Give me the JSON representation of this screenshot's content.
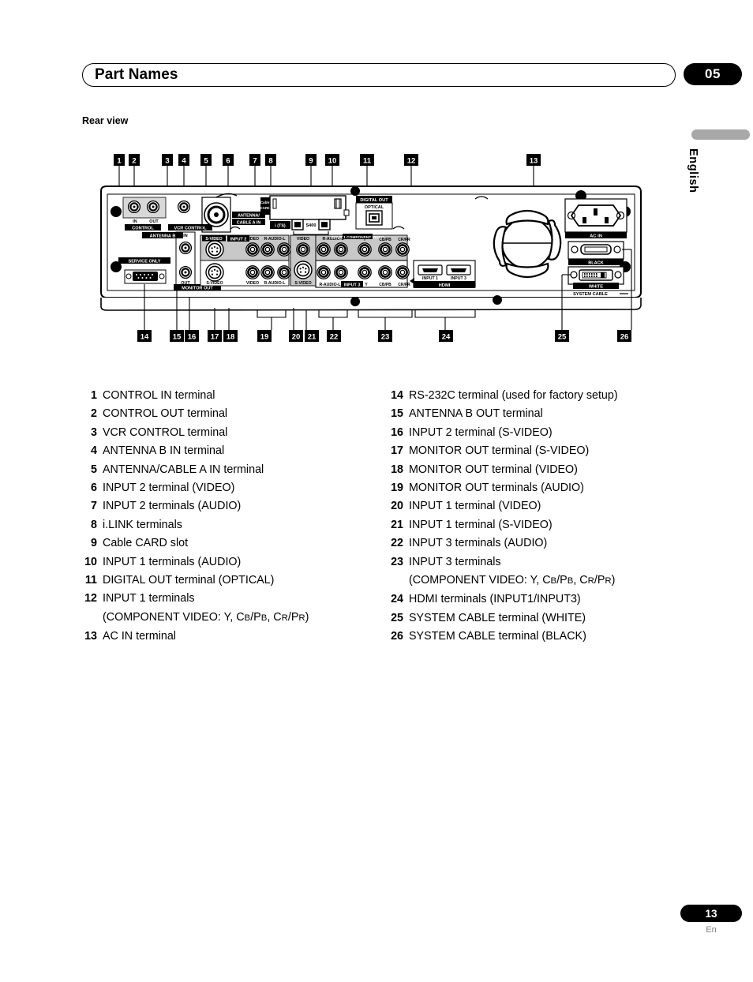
{
  "header": {
    "title": "Part Names",
    "chapter": "05"
  },
  "section": {
    "label": "Rear view"
  },
  "margin": {
    "language": "English"
  },
  "footer": {
    "page_number": "13",
    "language_code": "En"
  },
  "diagram": {
    "name": "rear-panel-connector-diagram",
    "top_callouts": [
      "1",
      "2",
      "3",
      "4",
      "5",
      "6",
      "7",
      "8",
      "9",
      "10",
      "11",
      "12",
      "13"
    ],
    "bottom_callouts": [
      "14",
      "15",
      "16",
      "17",
      "18",
      "19",
      "20",
      "21",
      "22",
      "23",
      "24",
      "25",
      "26"
    ],
    "panel_labels": [
      "IN",
      "OUT",
      "CONTROL",
      "VCR CONTROL",
      "ANTENNA B",
      "IN",
      "OUT",
      "ANTENNA/",
      "CABLE A IN",
      "SERVICE ONLY",
      "MONITOR OUT",
      "S-VIDEO",
      "INPUT 2",
      "VIDEO",
      "R-AUDIO-L",
      "S-VIDEO",
      "VIDEO",
      "R-AUDIO-L",
      "Cable",
      "CARD",
      "i (TS)",
      "S400",
      "DIGITAL OUT",
      "OPTICAL",
      "VIDEO",
      "S-VIDEO",
      "R-AUDIO-L",
      "INPUT 1",
      "COMPONENT VIDEO",
      "Y",
      "CB/PB",
      "CR/PR",
      "INPUT 3",
      "R-AUDIO-L",
      "Y",
      "CB/PB",
      "CR/PR",
      "INPUT 1",
      "INPUT 3",
      "HDMI",
      "AC IN",
      "BLACK",
      "WHITE",
      "SYSTEM CABLE"
    ]
  },
  "terminals": {
    "left": [
      {
        "num": "1",
        "text": "CONTROL IN terminal"
      },
      {
        "num": "2",
        "text": "CONTROL OUT terminal"
      },
      {
        "num": "3",
        "text": "VCR CONTROL terminal"
      },
      {
        "num": "4",
        "text": "ANTENNA B IN terminal"
      },
      {
        "num": "5",
        "text": "ANTENNA/CABLE A IN terminal"
      },
      {
        "num": "6",
        "text": "INPUT 2 terminal (VIDEO)"
      },
      {
        "num": "7",
        "text": "INPUT 2 terminals (AUDIO)"
      },
      {
        "num": "8",
        "text": "i.LINK terminals"
      },
      {
        "num": "9",
        "text": "Cable CARD slot"
      },
      {
        "num": "10",
        "text": "INPUT 1 terminals (AUDIO)"
      },
      {
        "num": "11",
        "text": "DIGITAL OUT terminal (OPTICAL)"
      },
      {
        "num": "12",
        "text": "INPUT 1 terminals",
        "cont_pre": "(COMPONENT VIDEO: Y, C",
        "cont_sub1": "B",
        "cont_mid1": "/P",
        "cont_sub2": "B",
        "cont_mid2": ", C",
        "cont_sub3": "R",
        "cont_mid3": "/P",
        "cont_sub4": "R",
        "cont_post": ")"
      },
      {
        "num": "13",
        "text": "AC IN terminal"
      }
    ],
    "right": [
      {
        "num": "14",
        "text": "RS-232C terminal (used for factory setup)"
      },
      {
        "num": "15",
        "text": "ANTENNA B OUT terminal"
      },
      {
        "num": "16",
        "text": "INPUT 2 terminal (S-VIDEO)"
      },
      {
        "num": "17",
        "text": "MONITOR OUT terminal (S-VIDEO)"
      },
      {
        "num": "18",
        "text": "MONITOR OUT terminal (VIDEO)"
      },
      {
        "num": "19",
        "text": "MONITOR OUT terminals (AUDIO)"
      },
      {
        "num": "20",
        "text": "INPUT 1 terminal (VIDEO)"
      },
      {
        "num": "21",
        "text": "INPUT 1 terminal (S-VIDEO)"
      },
      {
        "num": "22",
        "text": "INPUT 3 terminals (AUDIO)"
      },
      {
        "num": "23",
        "text": "INPUT 3 terminals",
        "cont_pre": "(COMPONENT VIDEO: Y, C",
        "cont_sub1": "B",
        "cont_mid1": "/P",
        "cont_sub2": "B",
        "cont_mid2": ", C",
        "cont_sub3": "R",
        "cont_mid3": "/P",
        "cont_sub4": "R",
        "cont_post": ")"
      },
      {
        "num": "24",
        "text": "HDMI terminals (INPUT1/INPUT3)"
      },
      {
        "num": "25",
        "text": "SYSTEM CABLE terminal (WHITE)"
      },
      {
        "num": "26",
        "text": "SYSTEM CABLE terminal (BLACK)"
      }
    ]
  }
}
